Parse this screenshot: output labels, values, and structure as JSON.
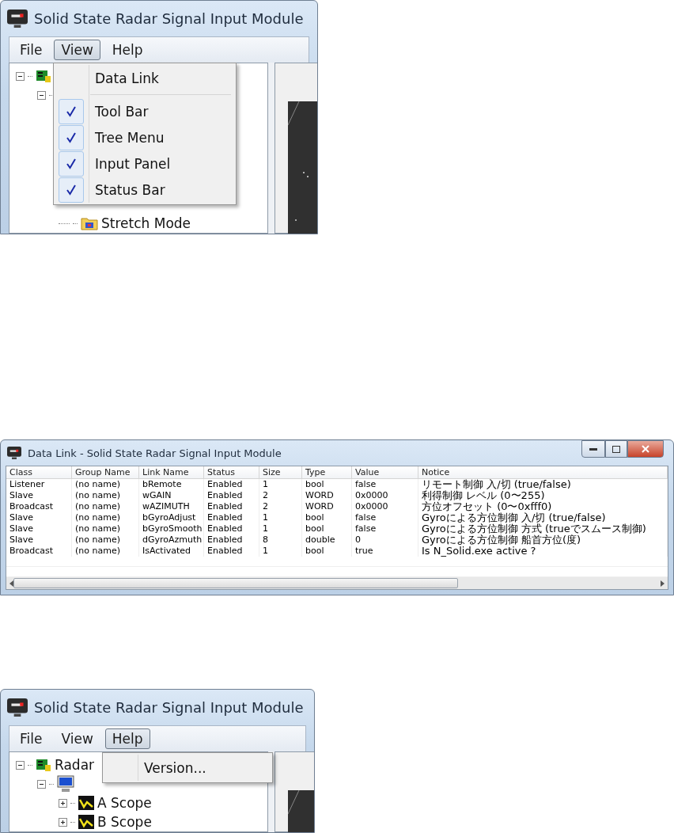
{
  "windows": [
    {
      "kind": "main",
      "title": "Solid State Radar Signal Input Module",
      "menu_bar": [
        {
          "label": "File",
          "selected": false
        },
        {
          "label": "View",
          "selected": true
        },
        {
          "label": "Help",
          "selected": false
        }
      ],
      "tree": [
        {
          "expanded": true,
          "children": [
            {
              "expanded": true,
              "children": [
                {
                  "label": "Stretch Mode"
                }
              ]
            }
          ]
        }
      ],
      "dropdown": [
        {
          "kind": "item",
          "label": "Data Link",
          "checked": false
        },
        {
          "kind": "separator"
        },
        {
          "kind": "item",
          "label": "Tool Bar",
          "checked": true
        },
        {
          "kind": "item",
          "label": "Tree Menu",
          "checked": true
        },
        {
          "kind": "item",
          "label": "Input Panel",
          "checked": true
        },
        {
          "kind": "item",
          "label": "Status Bar",
          "checked": true
        }
      ]
    },
    {
      "kind": "table",
      "title": "Data Link - Solid State Radar Signal Input Module",
      "columns": [
        "Class",
        "Group Name",
        "Link Name",
        "Status",
        "Size",
        "Type",
        "Value",
        "Notice"
      ],
      "rows": [
        [
          "Listener",
          "(no name)",
          "bRemote",
          "Enabled",
          "1",
          "bool",
          "false",
          "リモート制御 入/切 (true/false)"
        ],
        [
          "Slave",
          "(no name)",
          "wGAIN",
          "Enabled",
          "2",
          "WORD",
          "0x0000",
          "利得制御 レベル (0〜255)"
        ],
        [
          "Broadcast",
          "(no name)",
          "wAZIMUTH",
          "Enabled",
          "2",
          "WORD",
          "0x0000",
          "方位オフセット (0〜0xfff0)"
        ],
        [
          "Slave",
          "(no name)",
          "bGyroAdjust",
          "Enabled",
          "1",
          "bool",
          "false",
          "Gyroによる方位制御 入/切 (true/false)"
        ],
        [
          "Slave",
          "(no name)",
          "bGyroSmooth",
          "Enabled",
          "1",
          "bool",
          "false",
          "Gyroによる方位制御 方式 (trueでスムース制御)"
        ],
        [
          "Slave",
          "(no name)",
          "dGyroAzmuth",
          "Enabled",
          "8",
          "double",
          "0",
          "Gyroによる方位制御 船首方位(度)"
        ],
        [
          "Broadcast",
          "(no name)",
          "IsActivated",
          "Enabled",
          "1",
          "bool",
          "true",
          "Is N_Solid.exe active ?"
        ]
      ]
    },
    {
      "kind": "main",
      "title": "Solid State Radar Signal Input Module",
      "menu_bar": [
        {
          "label": "File",
          "selected": false
        },
        {
          "label": "View",
          "selected": false
        },
        {
          "label": "Help",
          "selected": true
        }
      ],
      "tree": [
        {
          "label": "Radar",
          "expanded": true,
          "children": [
            {
              "expanded": true,
              "children": [
                {
                  "label": "A Scope",
                  "expanded": false
                },
                {
                  "label": "B Scope",
                  "expanded": false
                }
              ]
            }
          ]
        }
      ],
      "dropdown": [
        {
          "kind": "item",
          "label": "Version..."
        }
      ]
    }
  ]
}
